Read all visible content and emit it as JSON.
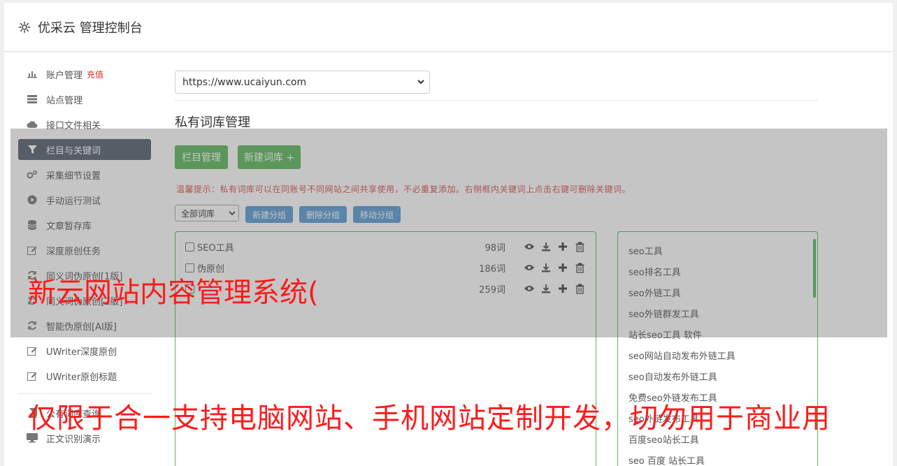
{
  "header": {
    "title": "优采云 管理控制台",
    "icon": "gear-icon"
  },
  "sidebar": {
    "items": [
      {
        "label": "账户管理",
        "icon": "bar-chart-icon",
        "badge": "充值"
      },
      {
        "label": "站点管理",
        "icon": "server-icon"
      },
      {
        "label": "接口文件相关",
        "icon": "cloud-upload-icon"
      },
      {
        "label": "栏目与关键词",
        "icon": "filter-icon",
        "active": true
      },
      {
        "label": "采集细节设置",
        "icon": "cogs-icon"
      },
      {
        "label": "手动运行测试",
        "icon": "play-circle-icon"
      },
      {
        "label": "文章暂存库",
        "icon": "database-icon"
      },
      {
        "label": "深度原创任务",
        "icon": "edit-icon"
      },
      {
        "label": "同义词伪原创[1版]",
        "icon": "refresh-icon"
      },
      {
        "label": "同义词伪原创[2版]",
        "icon": "refresh-icon"
      },
      {
        "label": "智能伪原创[AI版]",
        "icon": "refresh-icon"
      },
      {
        "label": "UWriter深度原创",
        "icon": "edit-icon"
      },
      {
        "label": "UWriter原创标题",
        "icon": "edit-icon"
      }
    ],
    "items2": [
      {
        "label": "公有词库查询",
        "icon": "book-icon"
      },
      {
        "label": "正文识别演示",
        "icon": "monitor-icon"
      }
    ]
  },
  "main": {
    "site_select": "https://www.ucaiyun.com",
    "section_title": "私有词库管理",
    "btn_columns": "栏目管理",
    "btn_new_lib": "新建词库 +",
    "tip": "温馨提示：私有词库可以在同账号不同网站之间共享使用，不必重复添加。右侧框内关键词上点击右键可删除关键词。",
    "group_select": "全部词库",
    "btn_new_group": "新建分组",
    "btn_delete_group": "删除分组",
    "btn_move_group": "移动分组",
    "libraries": [
      {
        "name": "SEO工具",
        "count": "98词"
      },
      {
        "name": "伪原创",
        "count": "186词"
      },
      {
        "name": "",
        "count": "259词"
      }
    ],
    "keywords": [
      "seo工具",
      "seo排名工具",
      "seo外链工具",
      "seo外链群发工具",
      "站长seo工具 软件",
      "seo网站自动发布外链工具",
      "seo自动发布外链工具",
      "免费seo外链发布工具",
      "seo外链发布工具",
      "百度seo站长工具",
      "seo 百度 站长工具"
    ]
  },
  "watermark": {
    "line1": "新云网站内容管理系统(",
    "line2": "仅限于合一支持电脑网站、手机网站定制开发，切勿用于商业用"
  },
  "colors": {
    "accent_green": "#5cb85c",
    "active_bg": "#56606f",
    "tip_red": "#d9534f",
    "blue_btn": "#5b9bd5"
  }
}
